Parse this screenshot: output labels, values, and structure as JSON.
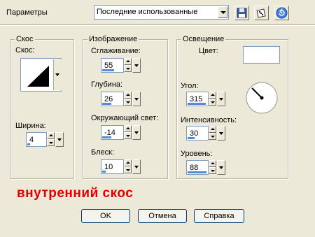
{
  "header": {
    "params_label": "Параметры",
    "preset_value": "Последние использованные"
  },
  "bevel": {
    "group_title": "Скос",
    "bevel_label": "Скос:",
    "width_label": "Ширина:",
    "width_value": "4"
  },
  "image": {
    "group_title": "Изображение",
    "smoothness_label": "Сглаживание:",
    "smoothness_value": "55",
    "depth_label": "Глубина:",
    "depth_value": "26",
    "ambience_label": "Окружающий свет:",
    "ambience_value": "-14",
    "shininess_label": "Блеск:",
    "shininess_value": "10"
  },
  "lighting": {
    "group_title": "Освещение",
    "color_label": "Цвет:",
    "color_value": "#ffffff",
    "angle_label": "Угол:",
    "angle_value": "315",
    "intensity_label": "Интенсивность:",
    "intensity_value": "30",
    "elevation_label": "Уровень:",
    "elevation_value": "88"
  },
  "caption": {
    "text": "внутренний скос",
    "color": "#e00000"
  },
  "buttons": {
    "ok": "OK",
    "cancel": "Отмена",
    "help": "Справка"
  },
  "icons": [
    "save-icon",
    "dice-icon",
    "reset-arrow-icon",
    "bevel-preview-icon",
    "angle-dial-icon"
  ]
}
